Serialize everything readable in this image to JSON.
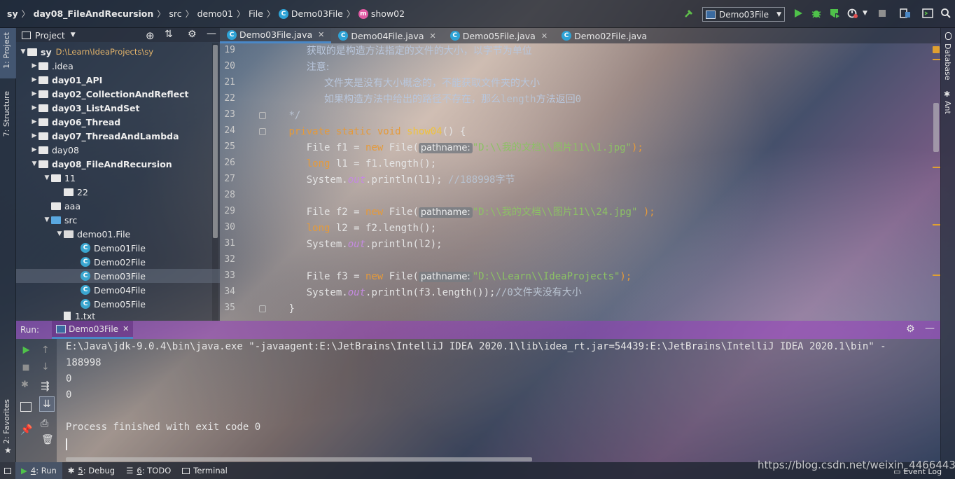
{
  "navbar": {
    "crumbs": [
      "sy",
      "day08_FileAndRecursion",
      "src",
      "demo01",
      "File",
      "Demo03File",
      "show02"
    ],
    "run_config": "Demo03File"
  },
  "left_stripe": {
    "project_tab": "1: Project",
    "structure_tab": "7: Structure",
    "favorites_tab": "2: Favorites"
  },
  "right_stripe": {
    "database_tab": "Database",
    "ant_tab": "Ant"
  },
  "project": {
    "title": "Project",
    "tree": [
      {
        "label": "sy",
        "path": "D:\\Learn\\IdeaProjects\\sy"
      },
      {
        "label": ".idea"
      },
      {
        "label": "day01_API"
      },
      {
        "label": "day02_CollectionAndReflect"
      },
      {
        "label": "day03_ListAndSet"
      },
      {
        "label": "day06_Thread"
      },
      {
        "label": "day07_ThreadAndLambda"
      },
      {
        "label": "day08"
      },
      {
        "label": "day08_FileAndRecursion"
      },
      {
        "label": "11"
      },
      {
        "label": "22"
      },
      {
        "label": "aaa"
      },
      {
        "label": "src"
      },
      {
        "label": "demo01.File"
      },
      {
        "label": "Demo01File"
      },
      {
        "label": "Demo02File"
      },
      {
        "label": "Demo03File"
      },
      {
        "label": "Demo04File"
      },
      {
        "label": "Demo05File"
      },
      {
        "label": "1.txt"
      }
    ]
  },
  "editor": {
    "tabs": [
      {
        "label": "Demo03File.java",
        "active": true
      },
      {
        "label": "Demo04File.java"
      },
      {
        "label": "Demo05File.java"
      },
      {
        "label": "Demo02File.java"
      }
    ],
    "line_numbers": [
      "19",
      "20",
      "21",
      "22",
      "23",
      "24",
      "25",
      "26",
      "27",
      "28",
      "29",
      "30",
      "31",
      "32",
      "33",
      "34",
      "35"
    ],
    "code": {
      "l19": "获取的是构造方法指定的文件的大小，以字节为单位",
      "l20": "注意:",
      "l21": "文件夹是没有大小概念的，不能获取文件夹的大小",
      "l22a": "如果构造方法中给出的路径不存在，那么",
      "l22b": "length",
      "l22c": "方法返回",
      "l22d": "0",
      "l23": "*/",
      "l24_kw": "private static void",
      "l24_fn": "show04",
      "l24_rest": "() {",
      "new_kw": "new",
      "long_kw": "long",
      "hint": "pathname:",
      "l25_a": "File f1 = ",
      "l25_b": " File(",
      "l25_str": "\"D:\\\\我的文档\\\\图片11\\\\1.jpg\"",
      "l25_end": ");",
      "l26_b": " l1 = f1.length();",
      "l27_a": "System.",
      "out": "out",
      "l27_b": ".println(l1); ",
      "l27_cm": "//188998字节",
      "l29_a": "File f2 = ",
      "l29_str": "\"D:\\\\我的文档\\\\图片11\\\\24.jpg\"",
      "l29_end": " );",
      "l30_b": " l2 = f2.length();",
      "l31_b": ".println(l2);",
      "l33_a": "File f3 = ",
      "l33_str": "\"D:\\\\Learn\\\\IdeaProjects\"",
      "l34_b": ".println(f3.length());",
      "l34_cm": "//0文件夹没有大小",
      "l35": "}"
    }
  },
  "run": {
    "label": "Run:",
    "tab": "Demo03File",
    "console": [
      "E:\\Java\\jdk-9.0.4\\bin\\java.exe \"-javaagent:E:\\JetBrains\\IntelliJ IDEA 2020.1\\lib\\idea_rt.jar=54439:E:\\JetBrains\\IntelliJ IDEA 2020.1\\bin\" -",
      "188998",
      "0",
      "0",
      "",
      "Process finished with exit code 0"
    ]
  },
  "statusbar": {
    "run": {
      "num": "4",
      "label": ": Run"
    },
    "debug": {
      "num": "5",
      "label": ": Debug"
    },
    "todo": {
      "num": "6",
      "label": ": TODO"
    },
    "terminal": "Terminal",
    "event_log": "Event Log"
  },
  "watermark": "https://blog.csdn.net/weixin_44664432",
  "colors": {
    "keyword": "#e59a3a",
    "string": "#8cc165",
    "accent": "#4a88c7",
    "run_header": "#963cbe"
  }
}
